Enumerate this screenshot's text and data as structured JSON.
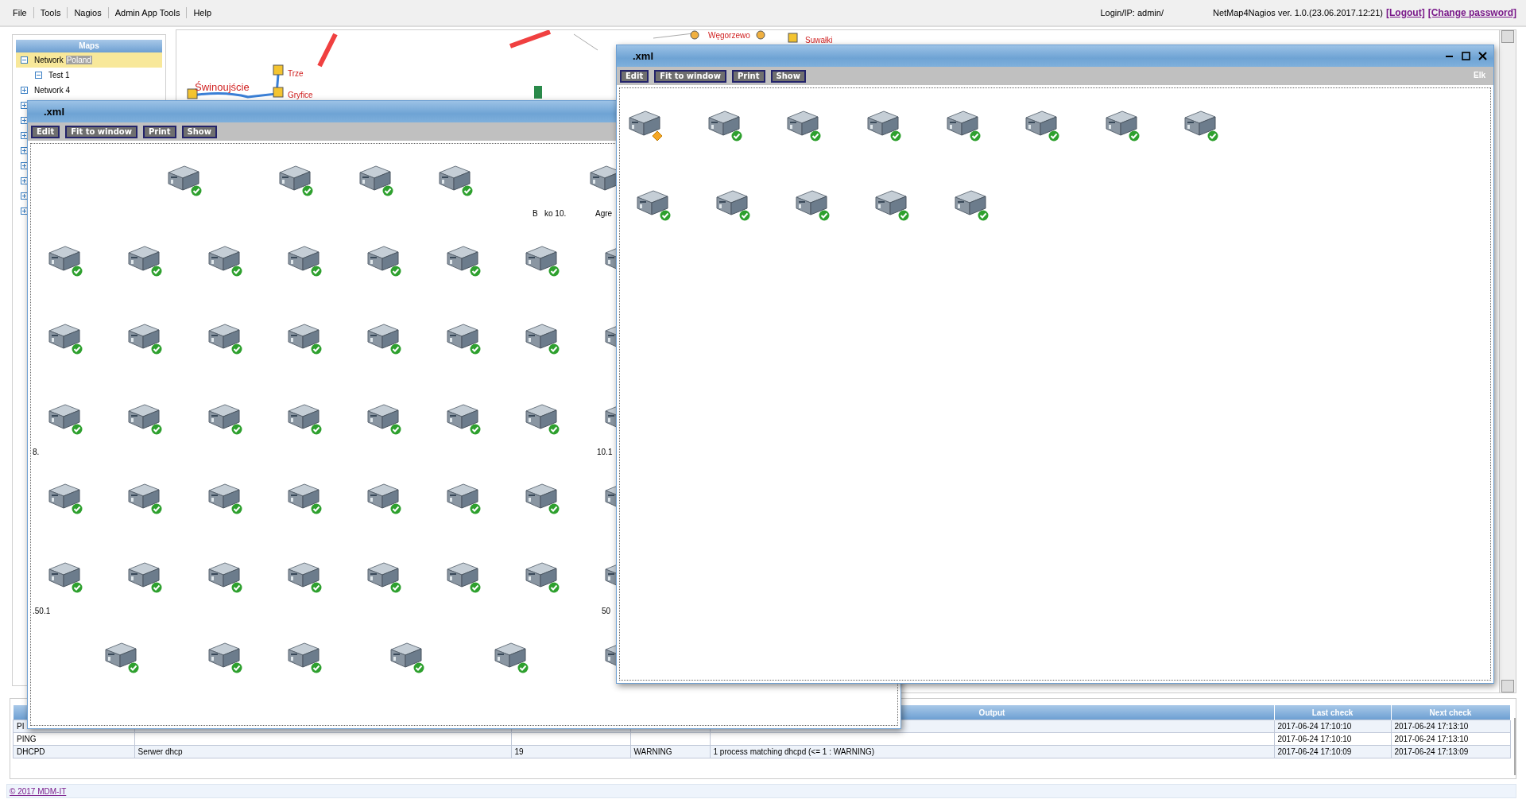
{
  "menu": [
    {
      "label": "File"
    },
    {
      "label": "Tools"
    },
    {
      "label": "Nagios"
    },
    {
      "label": "Admin App Tools"
    },
    {
      "label": "Help"
    }
  ],
  "session": {
    "login": "Login/IP: admin/",
    "version": "NetMap4Nagios ver. 1.0.(23.06.2017.12:21)",
    "logout": "[Logout]",
    "change_password": "[Change password]"
  },
  "sidebar": {
    "title": "Maps",
    "items": [
      {
        "label": "Network",
        "tag": "Poland",
        "selected": true,
        "expanded": true,
        "children": [
          {
            "label": "Test 1",
            "selected": false,
            "expanded": true
          }
        ]
      },
      {
        "label": "Network 4",
        "selected": false,
        "expanded": false
      },
      {
        "expanded": false
      },
      {
        "expanded": false
      },
      {
        "expanded": false
      },
      {
        "expanded": false
      },
      {
        "expanded": false
      },
      {
        "expanded": false
      },
      {
        "expanded": false
      },
      {
        "expanded": false
      }
    ]
  },
  "map": {
    "places": [
      "Świnoujście",
      "Gryfice",
      "Trze",
      "Węgorzewo",
      "Suwałki"
    ]
  },
  "windows": [
    {
      "title": ".xml",
      "toolbar": [
        "Edit",
        "Fit to window",
        "Print",
        "Show"
      ],
      "nodes": [
        {
          "kind": "server",
          "warning": false
        },
        {
          "kind": "server",
          "warning": false
        },
        {
          "kind": "server",
          "warning": false
        },
        {
          "kind": "server",
          "warning": false
        },
        {
          "kind": "clipped"
        },
        {
          "kind": "server",
          "warning": false
        },
        {
          "kind": "server",
          "warning": false
        },
        {
          "kind": "server",
          "warning": false
        },
        {
          "kind": "server",
          "warning": false
        },
        {
          "kind": "server",
          "warning": false
        },
        {
          "kind": "server",
          "warning": false
        },
        {
          "kind": "server",
          "warning": false
        },
        {
          "kind": "clipped"
        },
        {
          "kind": "server",
          "warning": false
        },
        {
          "kind": "server",
          "warning": false
        },
        {
          "kind": "server",
          "warning": false
        },
        {
          "kind": "server",
          "warning": false
        },
        {
          "kind": "server",
          "warning": false
        },
        {
          "kind": "server",
          "warning": false
        },
        {
          "kind": "server",
          "warning": false
        },
        {
          "kind": "clipped"
        },
        {
          "kind": "server",
          "warning": false
        },
        {
          "kind": "server",
          "warning": false
        },
        {
          "kind": "server",
          "warning": false
        },
        {
          "kind": "server",
          "warning": false
        },
        {
          "kind": "server",
          "warning": false
        },
        {
          "kind": "server",
          "warning": false
        },
        {
          "kind": "server",
          "warning": false
        },
        {
          "kind": "clipped"
        },
        {
          "kind": "server",
          "warning": false
        },
        {
          "kind": "server",
          "warning": false
        },
        {
          "kind": "server",
          "warning": false
        },
        {
          "kind": "server",
          "warning": false
        },
        {
          "kind": "server",
          "warning": false
        },
        {
          "kind": "server",
          "warning": false
        },
        {
          "kind": "server",
          "warning": false
        },
        {
          "kind": "clipped"
        },
        {
          "kind": "server",
          "warning": false
        },
        {
          "kind": "server",
          "warning": false
        },
        {
          "kind": "server",
          "warning": false
        },
        {
          "kind": "server",
          "warning": false
        },
        {
          "kind": "server",
          "warning": false
        },
        {
          "kind": "server",
          "warning": false
        },
        {
          "kind": "server",
          "warning": false
        },
        {
          "kind": "clipped"
        },
        {
          "kind": "server",
          "warning": false
        },
        {
          "kind": "server",
          "warning": false
        },
        {
          "kind": "server",
          "warning": false
        },
        {
          "kind": "server",
          "warning": false
        },
        {
          "kind": "server",
          "warning": false
        },
        {
          "kind": "clipped"
        }
      ],
      "labels": [
        "B   ko 10.",
        "Agre",
        "8.",
        "10.1",
        ".50.1",
        "50"
      ]
    },
    {
      "title": ".xml",
      "controls": true,
      "location": "Elk",
      "toolbar": [
        "Edit",
        "Fit to window",
        "Print",
        "Show"
      ],
      "nodes": [
        {
          "kind": "server",
          "warning": true
        },
        {
          "kind": "server",
          "warning": false
        },
        {
          "kind": "server",
          "warning": false
        },
        {
          "kind": "server",
          "warning": false
        },
        {
          "kind": "server",
          "warning": false
        },
        {
          "kind": "server",
          "warning": false
        },
        {
          "kind": "server",
          "warning": false
        },
        {
          "kind": "server",
          "warning": false
        },
        {
          "kind": "server",
          "warning": false
        },
        {
          "kind": "server",
          "warning": false
        },
        {
          "kind": "server",
          "warning": false
        },
        {
          "kind": "server",
          "warning": false
        },
        {
          "kind": "server",
          "warning": false
        }
      ]
    }
  ],
  "status_table": {
    "headers": {
      "column_5": "Output",
      "column_6": "Last check",
      "column_7": "Next check"
    },
    "rows": [
      {
        "column_1": "PI",
        "column_6": "2017-06-24 17:10:10",
        "column_7": "2017-06-24 17:13:10"
      },
      {
        "column_1": "PING",
        "column_6": "2017-06-24 17:10:10",
        "column_7": "2017-06-24 17:13:10"
      },
      {
        "column_1": "DHCPD",
        "column_2": "Serwer dhcp",
        "column_3": "19",
        "column_4": "WARNING",
        "column_5": "1 process matching dhcpd (<= 1 : WARNING)",
        "column_6": "2017-06-24 17:10:09",
        "column_7": "2017-06-24 17:13:09"
      }
    ]
  },
  "footer": {
    "copyright": "© 2017 MDM-IT"
  }
}
